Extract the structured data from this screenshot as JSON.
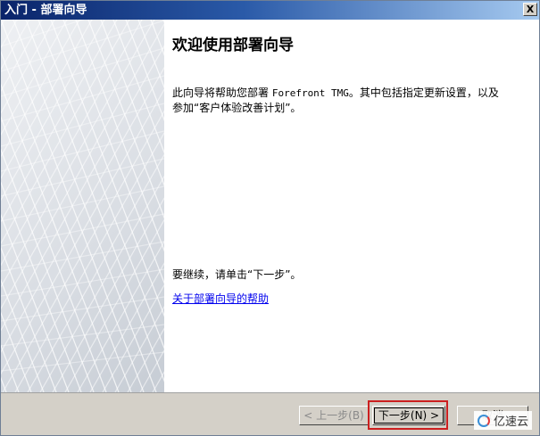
{
  "window": {
    "title": "入门 - 部署向导",
    "close_label": "X"
  },
  "content": {
    "heading": "欢迎使用部署向导",
    "description_part1": "此向导将帮助您部署 ",
    "description_product": "Forefront TMG",
    "description_part2": "。其中包括指定更新设置，以及参加“客户体验改善计划”。",
    "continue_text": "要继续，请单击“下一步”。",
    "help_link": "关于部署向导的帮助"
  },
  "buttons": {
    "back": "< 上一步(B)",
    "next": "下一步(N) >",
    "cancel": "取消"
  },
  "watermark": {
    "text": "亿速云",
    "icon": "yisu-logo-icon"
  },
  "colors": {
    "highlight": "#cc1f1f",
    "link": "#0000ee",
    "titlebar_start": "#0a246a"
  }
}
